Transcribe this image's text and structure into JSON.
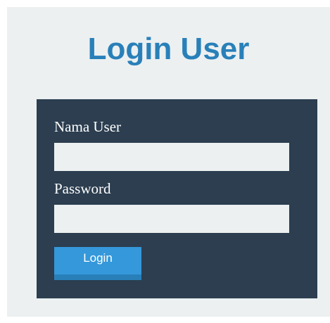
{
  "page": {
    "title": "Login User"
  },
  "form": {
    "username_label": "Nama User",
    "username_value": "",
    "password_label": "Password",
    "password_value": "",
    "submit_label": "Login"
  },
  "colors": {
    "page_background": "#ecf0f1",
    "title": "#2980b9",
    "panel": "#2c3e50",
    "field_background": "#ecf0f1",
    "button": "#3498db",
    "button_border": "#2980b9"
  }
}
